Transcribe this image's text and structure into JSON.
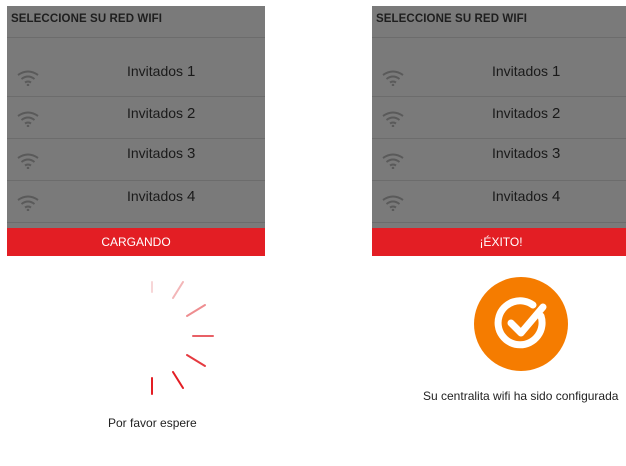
{
  "left_panel": {
    "title": "SELECCIONE SU RED WIFI",
    "networks": [
      {
        "name": "Invitados",
        "number": "1",
        "icon": "wifi-icon"
      },
      {
        "name": "Invitados",
        "number": "2",
        "icon": "wifi-icon"
      },
      {
        "name": "Invitados",
        "number": "3",
        "icon": "wifi-icon"
      },
      {
        "name": "Invitados",
        "number": "4",
        "icon": "wifi-icon"
      }
    ],
    "status": "CARGANDO"
  },
  "right_panel": {
    "title": "SELECCIONE SU RED WIFI",
    "networks": [
      {
        "name": "Invitados",
        "number": "1",
        "icon": "wifi-icon"
      },
      {
        "name": "Invitados",
        "number": "2",
        "icon": "wifi-icon"
      },
      {
        "name": "Invitados",
        "number": "3",
        "icon": "wifi-icon"
      },
      {
        "name": "Invitados",
        "number": "4",
        "icon": "wifi-icon"
      }
    ],
    "status": "¡ÉXITO!"
  },
  "loading": {
    "message": "Por favor espere",
    "icon": "loading-spinner-icon"
  },
  "success": {
    "message": "Su centralita wifi ha sido configurada",
    "icon": "check-circle-icon"
  },
  "colors": {
    "overlay": "#7a7a7a",
    "accent_red": "#e31e24",
    "success_orange": "#f57c00"
  }
}
